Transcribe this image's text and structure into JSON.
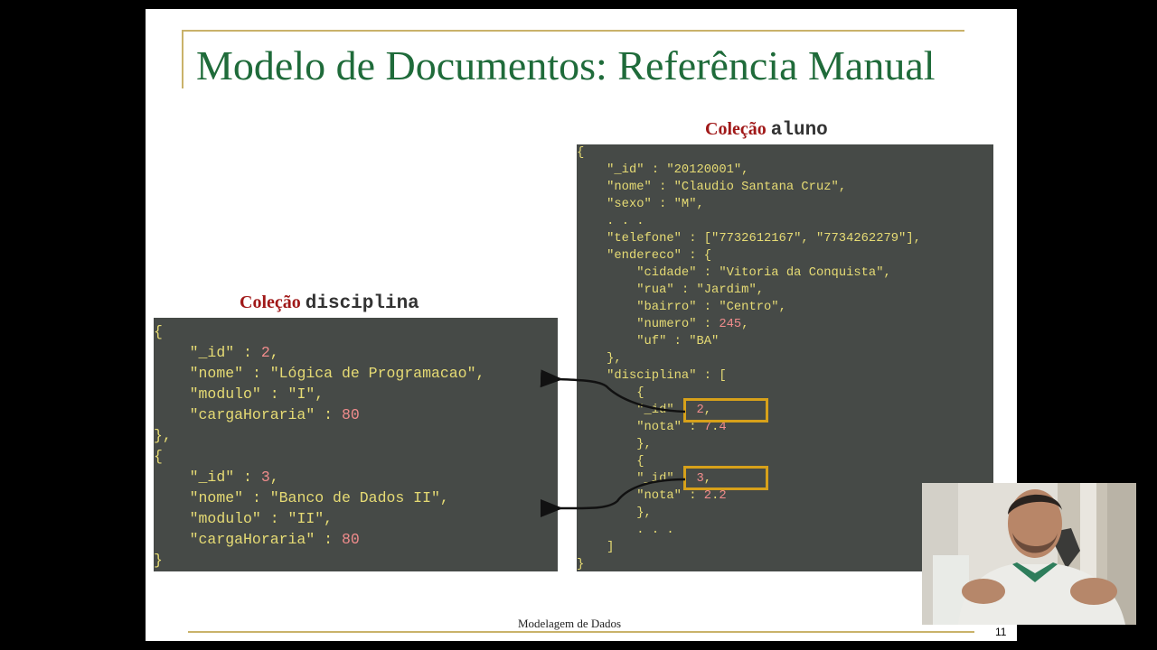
{
  "slide": {
    "title": "Modelo de Documentos: Referência Manual",
    "footer": "Modelagem de Dados",
    "page_number": "11"
  },
  "collections": {
    "disciplina": {
      "caption_prefix": "Coleção",
      "caption_name": "disciplina",
      "code_lines": [
        "{",
        "    \"_id\" : 2,",
        "    \"nome\" : \"Lógica de Programacao\",",
        "    \"modulo\" : \"I\",",
        "    \"cargaHoraria\" : 80",
        "},",
        "{",
        "    \"_id\" : 3,",
        "    \"nome\" : \"Banco de Dados II\",",
        "    \"modulo\" : \"II\",",
        "    \"cargaHoraria\" : 80",
        "}"
      ]
    },
    "aluno": {
      "caption_prefix": "Coleção",
      "caption_name": "aluno",
      "code_lines": [
        "{",
        "    \"_id\" : \"20120001\",",
        "    \"nome\" : \"Claudio Santana Cruz\",",
        "    \"sexo\" : \"M\",",
        "    . . .",
        "    \"telefone\" : [\"7732612167\", \"7734262279\"],",
        "    \"endereco\" : {",
        "        \"cidade\" : \"Vitoria da Conquista\",",
        "        \"rua\" : \"Jardim\",",
        "        \"bairro\" : \"Centro\",",
        "        \"numero\" : 245,",
        "        \"uf\" : \"BA\"",
        "    },",
        "    \"disciplina\" : [",
        "        {",
        "        \"_id\" : 2,",
        "        \"nota\" : 7.4",
        "        },",
        "        {",
        "        \"_id\" : 3,",
        "        \"nota\" : 2.2",
        "        },",
        "        . . .",
        "    ]",
        "}"
      ]
    }
  },
  "colors": {
    "title": "#1f6b3a",
    "caption": "#a01818",
    "code_background": "#464a47",
    "code_text": "#e6db74",
    "code_number": "#f08c8c",
    "highlight_box": "#d7a11a",
    "rule": "#c9b26a"
  },
  "webcam": {
    "icon": "presenter-video-icon"
  }
}
